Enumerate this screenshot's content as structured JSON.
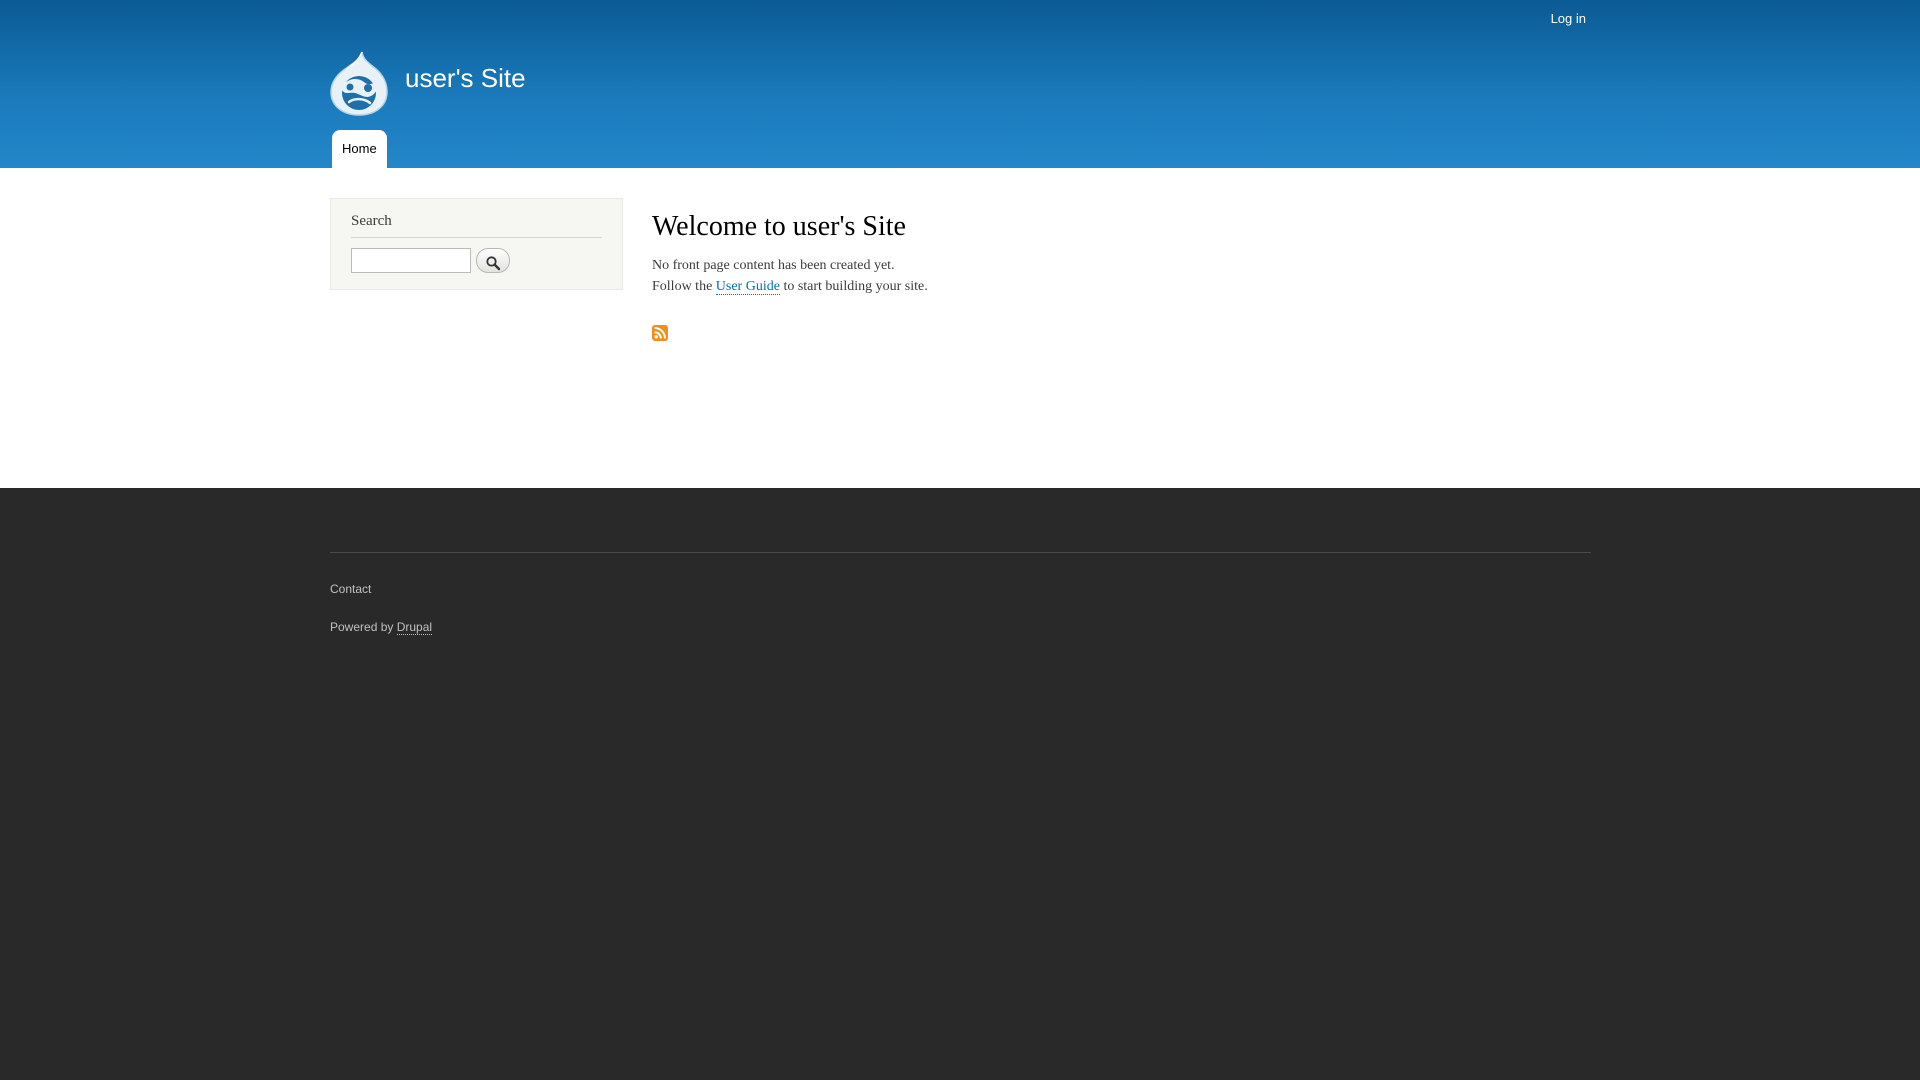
{
  "header": {
    "secondary_menu": {
      "login_label": "Log in"
    },
    "site_name": "user's Site",
    "logo_icon": "drupal-drop-icon",
    "main_menu": {
      "home_label": "Home"
    }
  },
  "sidebar": {
    "search_block": {
      "title": "Search",
      "input_value": "",
      "button_icon": "magnifier-icon"
    }
  },
  "content": {
    "title": "Welcome to user's Site",
    "line1": "No front page content has been created yet.",
    "line2_prefix": "Follow the ",
    "line2_link": "User Guide",
    "line2_suffix": " to start building your site.",
    "feed_icon": "rss-feed-icon"
  },
  "footer": {
    "contact_label": "Contact",
    "powered_prefix": "Powered by ",
    "powered_link": "Drupal"
  },
  "colors": {
    "header_top": "#0a5b94",
    "header_bottom": "#2287c8",
    "link": "#0071b3",
    "footer_bg": "#292929",
    "rss": "#f28e1e"
  }
}
